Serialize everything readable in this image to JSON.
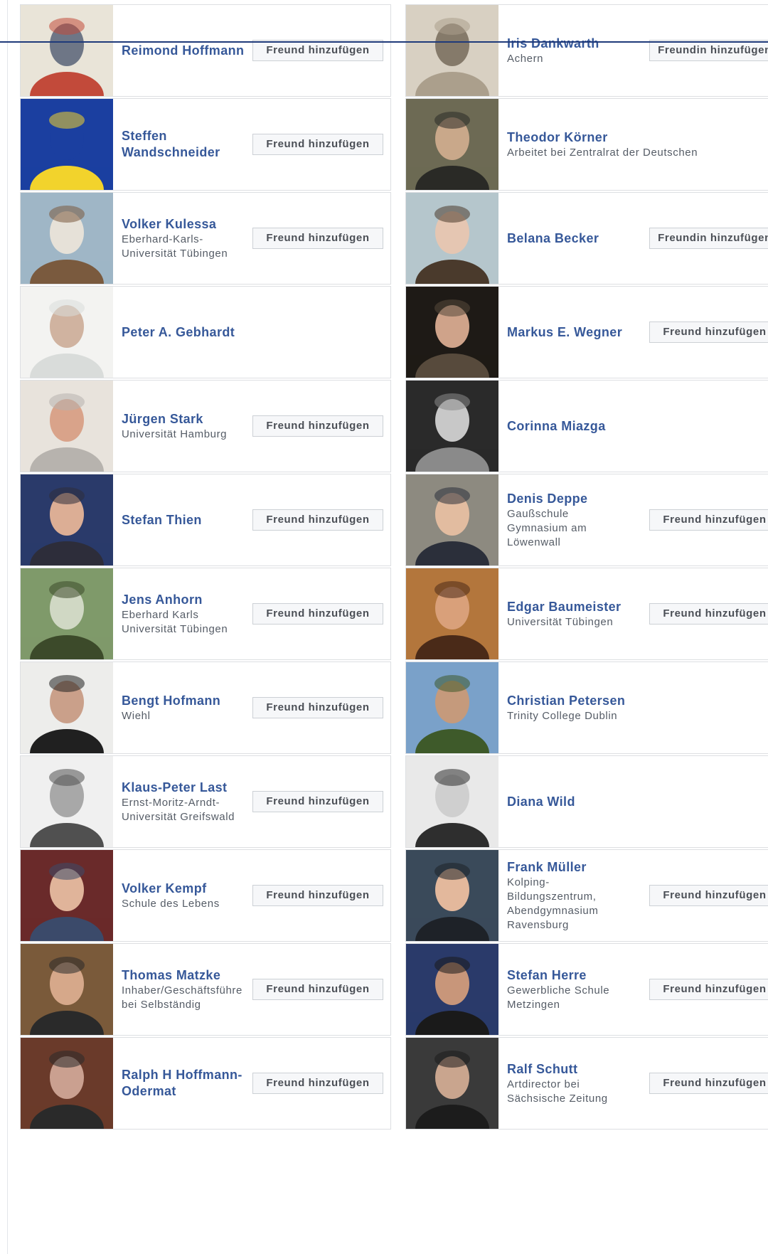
{
  "people": [
    {
      "name": "Reimond Hoffmann",
      "sub": "",
      "button": "Freund hinzufügen",
      "colors": [
        "#e9e4d8",
        "#c24a3a",
        "#6e7686"
      ]
    },
    {
      "name": "Iris Dankwarth",
      "sub": "Achern",
      "button": "Freundin hinzufügen",
      "colors": [
        "#d8d0c2",
        "#ab9f8c",
        "#857a6a"
      ]
    },
    {
      "name": "Steffen Wandschneider",
      "sub": "",
      "button": "Freund hinzufügen",
      "colors": [
        "#1b3fa0",
        "#f2d32c",
        "#1b3fa0"
      ]
    },
    {
      "name": "Theodor Körner",
      "sub": "Arbeitet bei Zentralrat der Deutschen",
      "button": "",
      "colors": [
        "#6d6a54",
        "#2a2a26",
        "#c9a88a"
      ]
    },
    {
      "name": "Volker Kulessa",
      "sub": "Eberhard-Karls-\nUniversität Tübingen",
      "button": "Freund hinzufügen",
      "colors": [
        "#9fb6c6",
        "#7a5a3e",
        "#e6e1d8"
      ]
    },
    {
      "name": "Belana Becker",
      "sub": "",
      "button": "Freundin hinzufügen",
      "colors": [
        "#b5c6cc",
        "#4a3a2c",
        "#e5c6b2"
      ]
    },
    {
      "name": "Peter A. Gebhardt",
      "sub": "",
      "button": "",
      "colors": [
        "#f3f3f1",
        "#d9dcda",
        "#d0b3a0"
      ]
    },
    {
      "name": "Markus E. Wegner",
      "sub": "",
      "button": "Freund hinzufügen",
      "colors": [
        "#1e1a16",
        "#574a3c",
        "#cfa38a"
      ]
    },
    {
      "name": "Jürgen Stark",
      "sub": "Universität Hamburg",
      "button": "Freund hinzufügen",
      "colors": [
        "#e8e3dc",
        "#b7b3ae",
        "#d9a38a"
      ]
    },
    {
      "name": "Corinna Miazga",
      "sub": "",
      "button": "",
      "colors": [
        "#2a2a2a",
        "#8a8a8a",
        "#c8c8c8"
      ]
    },
    {
      "name": "Stefan Thien",
      "sub": "",
      "button": "Freund hinzufügen",
      "colors": [
        "#2a3a6a",
        "#2d2d3a",
        "#dcae95"
      ]
    },
    {
      "name": "Denis Deppe",
      "sub": "Gaußschule\nGymnasium am\nLöwenwall",
      "button": "Freund hinzufügen",
      "colors": [
        "#8d8a80",
        "#2b2f3a",
        "#e2bca0"
      ]
    },
    {
      "name": "Jens Anhorn",
      "sub": "Eberhard Karls\nUniversität Tübingen",
      "button": "Freund hinzufügen",
      "colors": [
        "#7f9a6a",
        "#3c4a2a",
        "#d0d8c4"
      ]
    },
    {
      "name": "Edgar Baumeister",
      "sub": "Universität Tübingen",
      "button": "Freund hinzufügen",
      "colors": [
        "#b3763c",
        "#4a2a18",
        "#d9a07a"
      ]
    },
    {
      "name": "Bengt Hofmann",
      "sub": "Wiehl",
      "button": "Freund hinzufügen",
      "colors": [
        "#ededeb",
        "#202020",
        "#caa08a"
      ]
    },
    {
      "name": "Christian Petersen",
      "sub": "Trinity College Dublin",
      "button": "",
      "colors": [
        "#7aa1c9",
        "#3e5a2a",
        "#c59a7c"
      ]
    },
    {
      "name": "Klaus-Peter Last",
      "sub": "Ernst-Moritz-Arndt-\nUniversität Greifswald",
      "button": "Freund hinzufügen",
      "colors": [
        "#f0f0f0",
        "#505050",
        "#a8a8a8"
      ]
    },
    {
      "name": "Diana Wild",
      "sub": "",
      "button": "",
      "colors": [
        "#e9e9e9",
        "#2e2e2e",
        "#cfcfcf"
      ]
    },
    {
      "name": "Volker Kempf",
      "sub": "Schule des Lebens",
      "button": "Freund hinzufügen",
      "colors": [
        "#6a2a2a",
        "#3b4a6a",
        "#e0b49a"
      ]
    },
    {
      "name": "Frank Müller",
      "sub": "Kolping-\nBildungszentrum,\nAbendgymnasium\nRavensburg",
      "button": "Freund hinzufügen",
      "colors": [
        "#3a4a5a",
        "#1e2228",
        "#e3b89c"
      ]
    },
    {
      "name": "Thomas Matzke",
      "sub": "Inhaber/Geschäftsführe\nbei Selbständig",
      "button": "Freund hinzufügen",
      "colors": [
        "#7a5a3a",
        "#2a2a2a",
        "#d6a88a"
      ]
    },
    {
      "name": "Stefan Herre",
      "sub": "Gewerbliche Schule\nMetzingen",
      "button": "Freund hinzufügen",
      "colors": [
        "#2a3a6a",
        "#1a1a1a",
        "#c8967a"
      ]
    },
    {
      "name": "Ralph H Hoffmann-Odermat",
      "sub": "",
      "button": "Freund hinzufügen",
      "colors": [
        "#6a3a2a",
        "#2a2a2a",
        "#caa090"
      ]
    },
    {
      "name": "Ralf Schutt",
      "sub": "Artdirector bei\nSächsische Zeitung",
      "button": "Freund hinzufügen",
      "colors": [
        "#3a3a3a",
        "#1c1c1c",
        "#c9a58e"
      ]
    }
  ]
}
